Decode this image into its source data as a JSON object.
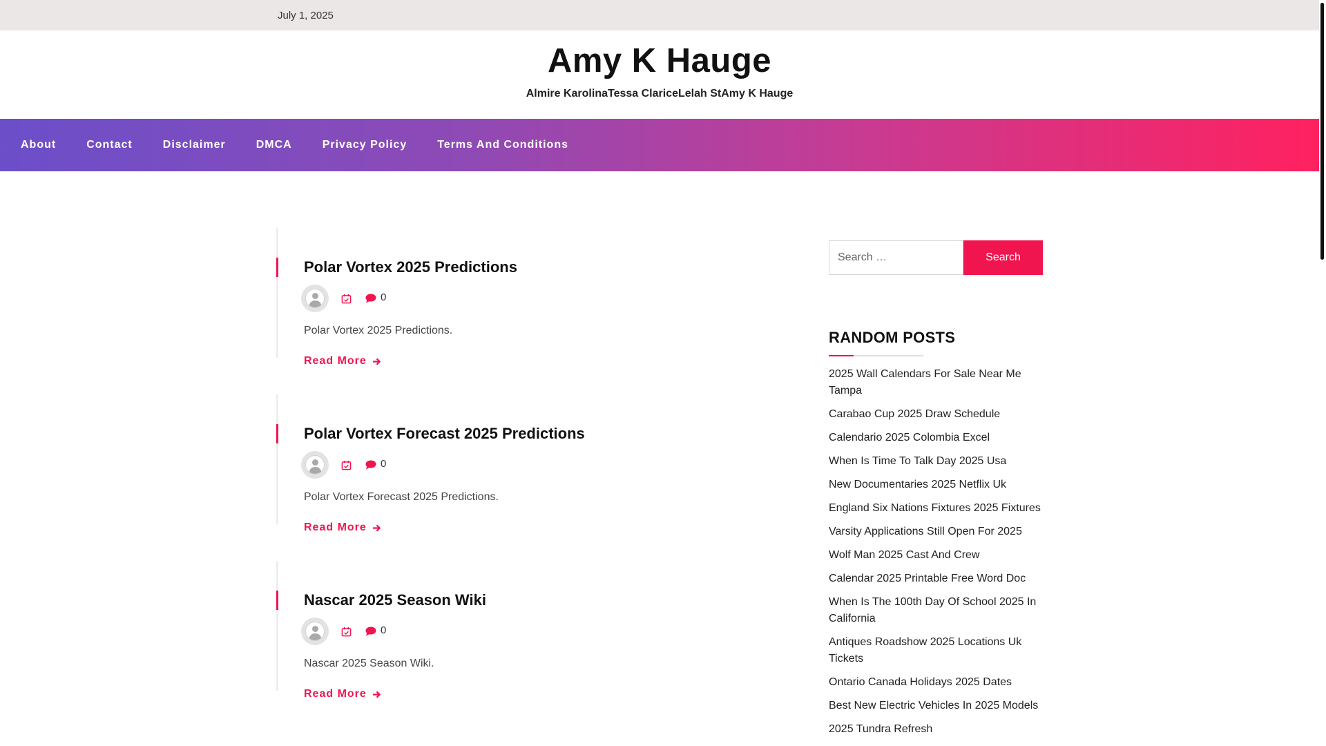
{
  "topbar": {
    "date": "July 1, 2025"
  },
  "site": {
    "title": "Amy K Hauge",
    "description": "Almire KarolinaTessa ClariceLelah StAmy K Hauge"
  },
  "nav": {
    "items": [
      "About",
      "Contact",
      "Disclaimer",
      "DMCA",
      "Privacy Policy",
      "Terms And Conditions"
    ]
  },
  "posts": [
    {
      "title": "Polar Vortex 2025 Predictions",
      "comments": "0",
      "excerpt": "Polar Vortex 2025 Predictions.",
      "read_more": "Read More"
    },
    {
      "title": "Polar Vortex Forecast 2025 Predictions",
      "comments": "0",
      "excerpt": "Polar Vortex Forecast 2025 Predictions.",
      "read_more": "Read More"
    },
    {
      "title": "Nascar 2025 Season Wiki",
      "comments": "0",
      "excerpt": "Nascar 2025 Season Wiki.",
      "read_more": "Read More"
    }
  ],
  "sidebar": {
    "search": {
      "placeholder": "Search …",
      "button": "Search"
    },
    "random_posts": {
      "title": "RANDOM POSTS",
      "items": [
        "2025 Wall Calendars For Sale Near Me Tampa",
        "Carabao Cup 2025 Draw Schedule",
        "Calendario 2025 Colombia Excel",
        "When Is Time To Talk Day 2025 Usa",
        "New Documentaries 2025 Netflix Uk",
        "England Six Nations Fixtures 2025 Fixtures",
        "Varsity Applications Still Open For 2025",
        "Wolf Man 2025 Cast And Crew",
        "Calendar 2025 Printable Free Word Doc",
        "When Is The 100th Day Of School 2025 In California",
        "Antiques Roadshow 2025 Locations Uk Tickets",
        "Ontario Canada Holidays 2025 Dates",
        "Best New Electric Vehicles In 2025 Models",
        "2025 Tundra Refresh"
      ]
    }
  },
  "colors": {
    "accent": "#f0144f",
    "nav_gradient_start": "#6b4fc9",
    "nav_gradient_end": "#ff2160",
    "topbar_bg": "#ebe7e7"
  },
  "icons": {
    "post_meta": [
      "avatar-icon",
      "calendar-icon",
      "comment-icon"
    ],
    "read_more": "arrow-right-icon"
  }
}
